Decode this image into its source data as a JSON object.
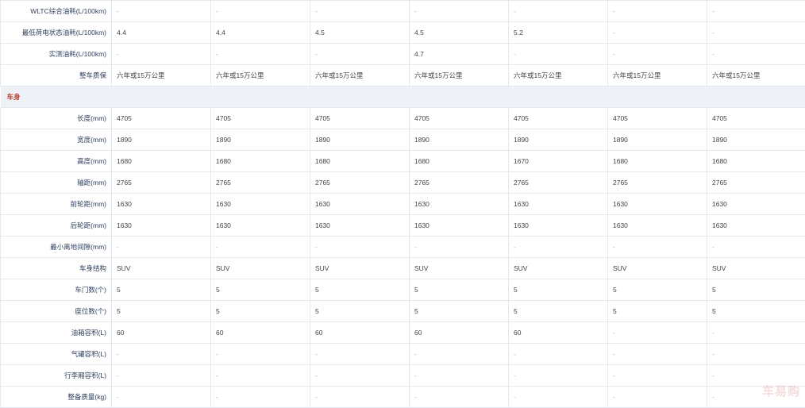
{
  "rows_top": [
    {
      "label": "WLTC综合油耗(L/100km)",
      "values": [
        "-",
        "-",
        "-",
        "-",
        "-",
        "-",
        "-"
      ]
    },
    {
      "label": "最低荷电状态油耗(L/100km)",
      "values": [
        "4.4",
        "4.4",
        "4.5",
        "4.5",
        "5.2",
        "-",
        "-"
      ]
    },
    {
      "label": "实测油耗(L/100km)",
      "values": [
        "-",
        "-",
        "-",
        "4.7",
        "-",
        "-",
        "-"
      ]
    },
    {
      "label": "整车质保",
      "values": [
        "六年或15万公里",
        "六年或15万公里",
        "六年或15万公里",
        "六年或15万公里",
        "六年或15万公里",
        "六年或15万公里",
        "六年或15万公里"
      ]
    }
  ],
  "section": {
    "title": "车身"
  },
  "rows_body": [
    {
      "label": "长度(mm)",
      "values": [
        "4705",
        "4705",
        "4705",
        "4705",
        "4705",
        "4705",
        "4705"
      ]
    },
    {
      "label": "宽度(mm)",
      "values": [
        "1890",
        "1890",
        "1890",
        "1890",
        "1890",
        "1890",
        "1890"
      ]
    },
    {
      "label": "高度(mm)",
      "values": [
        "1680",
        "1680",
        "1680",
        "1680",
        "1670",
        "1680",
        "1680"
      ]
    },
    {
      "label": "轴距(mm)",
      "values": [
        "2765",
        "2765",
        "2765",
        "2765",
        "2765",
        "2765",
        "2765"
      ]
    },
    {
      "label": "前轮距(mm)",
      "values": [
        "1630",
        "1630",
        "1630",
        "1630",
        "1630",
        "1630",
        "1630"
      ]
    },
    {
      "label": "后轮距(mm)",
      "values": [
        "1630",
        "1630",
        "1630",
        "1630",
        "1630",
        "1630",
        "1630"
      ]
    },
    {
      "label": "最小离地间隙(mm)",
      "values": [
        "-",
        "-",
        "-",
        "-",
        "-",
        "-",
        "-"
      ]
    },
    {
      "label": "车身结构",
      "values": [
        "SUV",
        "SUV",
        "SUV",
        "SUV",
        "SUV",
        "SUV",
        "SUV"
      ]
    },
    {
      "label": "车门数(个)",
      "values": [
        "5",
        "5",
        "5",
        "5",
        "5",
        "5",
        "5"
      ]
    },
    {
      "label": "座位数(个)",
      "values": [
        "5",
        "5",
        "5",
        "5",
        "5",
        "5",
        "5"
      ]
    },
    {
      "label": "油箱容积(L)",
      "values": [
        "60",
        "60",
        "60",
        "60",
        "60",
        "-",
        "-"
      ]
    },
    {
      "label": "气罐容积(L)",
      "values": [
        "-",
        "-",
        "-",
        "-",
        "-",
        "-",
        "-"
      ]
    },
    {
      "label": "行李厢容积(L)",
      "values": [
        "-",
        "-",
        "-",
        "-",
        "-",
        "-",
        "-"
      ]
    },
    {
      "label": "整备质量(kg)",
      "values": [
        "-",
        "-",
        "-",
        "-",
        "-",
        "-",
        "-"
      ]
    }
  ],
  "watermark": "车易购",
  "colors": {
    "section_title": "#c0392b",
    "section_bg": "#eef1f6",
    "border": "#e3e8ee"
  }
}
